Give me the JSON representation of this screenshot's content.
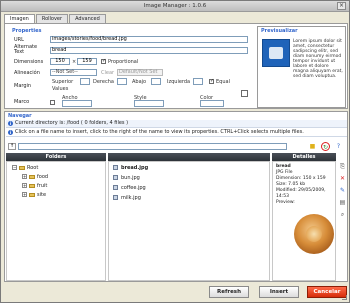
{
  "window": {
    "title": "Image Manager : 1.0.6",
    "close_glyph": "×"
  },
  "tabs": [
    {
      "label": "Imagen",
      "active": true
    },
    {
      "label": "Rollover",
      "active": false
    },
    {
      "label": "Advanced",
      "active": false
    }
  ],
  "properties": {
    "section_title": "Properties",
    "url_label": "URL",
    "url_value": "images/stories/food/bread.jpg",
    "alt_label_line1": "Alternate",
    "alt_label_line2": "Text",
    "alt_value": "bread",
    "dimensions_label": "Dimensions",
    "width_value": "150",
    "x_sep": "×",
    "height_value": "159",
    "proportional_label": "Proportional",
    "proportional_checked": true,
    "alignment_label": "Alineación",
    "alignment_value": "--Not Set--",
    "clear_label": "Clear",
    "clear_value": "Default/Not Set",
    "margin_label": "Margin",
    "margin_superior": "Superior",
    "margin_derecha": "Derecha",
    "margin_abajo": "Abajo",
    "margin_izquierda": "Izquierda",
    "equal_values_label_line1": "Equal",
    "equal_values_label_line2": "Values",
    "equal_values_checked": true,
    "border_label": "Marco",
    "ancho_label": "Ancho",
    "style_label": "Style",
    "color_label": "Color"
  },
  "preview": {
    "title": "Previsualizar",
    "text": "Lorem ipsum dolor sit amet, consectetur sadipscing elitr, sed diam nonumy eirmod tempor invidunt ut labore et dolore magna aliquyam erat, sed diam voluptua."
  },
  "browser": {
    "section_title": "Navegar",
    "current_directory": "Current directory is: /food ( 0 folders, 4 files )",
    "hint": "Click on a file name to insert, click to the right of the name to view its properties. CTRL+Click selects multiple files.",
    "folders_header": "Folders",
    "files_header": "",
    "details_header": "Detalles",
    "tree": [
      {
        "label": "Root",
        "sign": "−",
        "level": 0
      },
      {
        "label": "food",
        "sign": "+",
        "level": 1
      },
      {
        "label": "fruit",
        "sign": "+",
        "level": 1
      },
      {
        "label": "site",
        "sign": "+",
        "level": 1
      }
    ],
    "files": [
      {
        "name": "bread.jpg",
        "selected": true
      },
      {
        "name": "bun.jpg",
        "selected": false
      },
      {
        "name": "coffee.jpg",
        "selected": false
      },
      {
        "name": "milk.jpg",
        "selected": false
      }
    ],
    "details": {
      "name": "bread",
      "type": "JPG File",
      "dimensions": "Dimension: 150 x 159",
      "size": "Size: 7.05 kb",
      "modified": "Modified: 29/05/2009, 14:53",
      "preview_label": "Preview:"
    },
    "toolbar_icons": [
      "up-icon",
      "new-folder-icon",
      "refresh-icon",
      "help-icon"
    ],
    "side_icons": [
      "delete-icon",
      "rename-icon",
      "copy-icon",
      "zoom-icon"
    ]
  },
  "buttons": {
    "refresh": "Refresh",
    "insert": "Insert",
    "cancel": "Cancelar"
  },
  "colors": {
    "accent": "#3366cc",
    "cancel": "#d62d0a",
    "header_dark": "#2d3238"
  }
}
